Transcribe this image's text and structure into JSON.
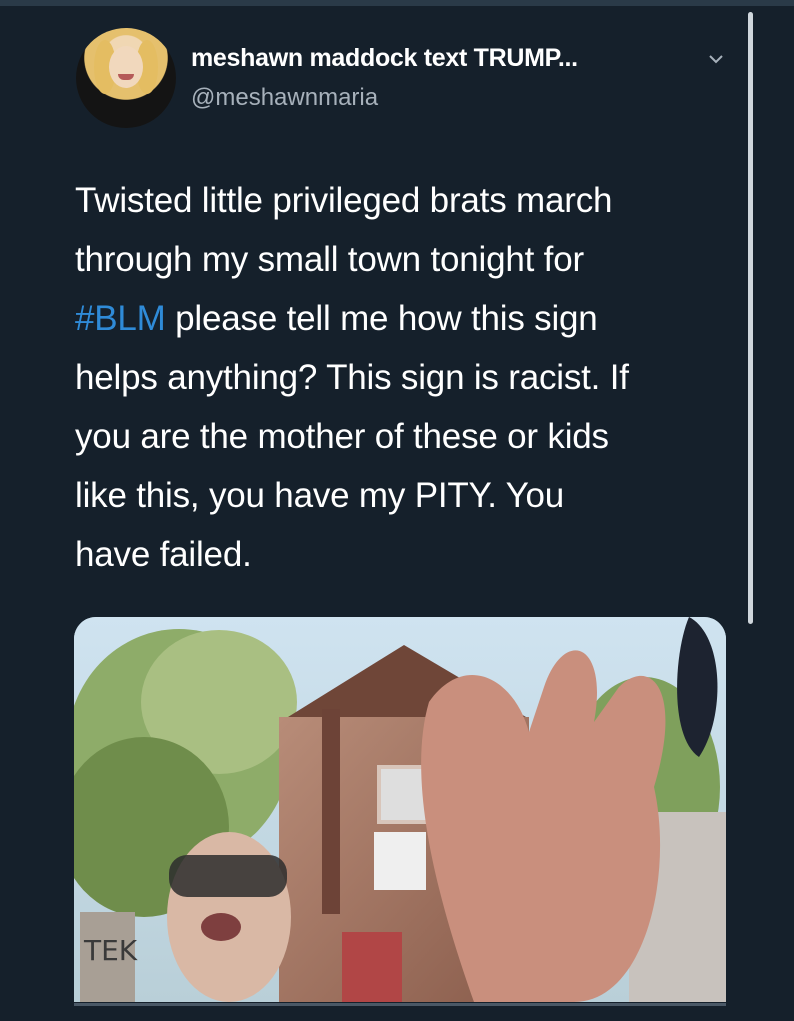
{
  "tweet": {
    "display_name": "meshawn maddock text TRUMP...",
    "handle": "@meshawnmaria",
    "text_lines": [
      "Twisted little privileged brats march",
      "through my small town tonight for",
      {
        "hashtag": "#BLM",
        "rest": " please tell me how this sign"
      },
      "helps anything? This sign is racist. If",
      "you are the mother of these or kids",
      "like this, you have my PITY. You",
      "have failed."
    ],
    "image": {
      "description_icon": "photo-icon",
      "sign_text": "TEK"
    }
  },
  "colors": {
    "background": "#15202b",
    "hashtag": "#2f8bd8",
    "handle": "#a7b1bb"
  }
}
